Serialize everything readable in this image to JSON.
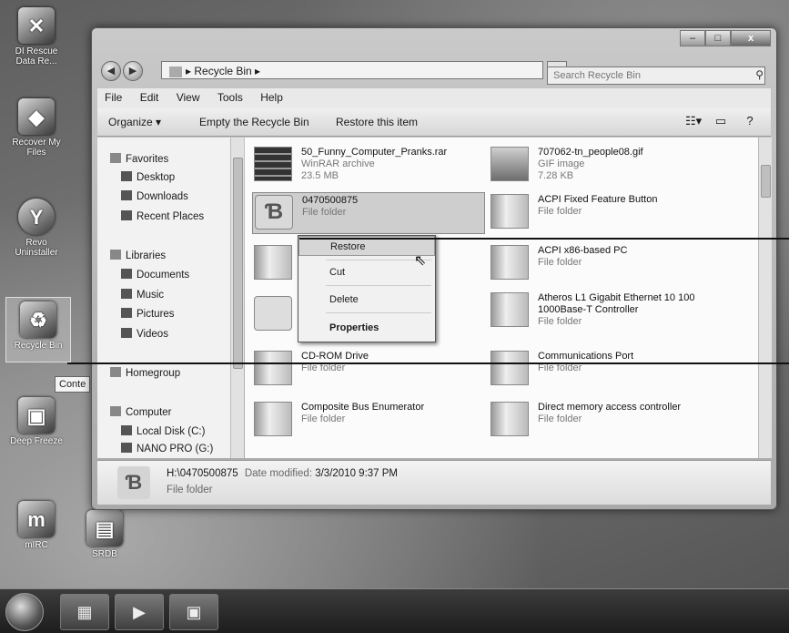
{
  "desktop": {
    "icons": [
      {
        "label": "DI Rescue Data Re..."
      },
      {
        "label": "Recover My Files"
      },
      {
        "label": "Revo Uninstaller"
      },
      {
        "label": "Recycle Bin"
      },
      {
        "label": "Deep Freeze"
      },
      {
        "label": "mIRC"
      },
      {
        "label": "SRDB"
      }
    ],
    "tooltip": "Conte"
  },
  "window": {
    "caption_min": "–",
    "caption_max": "□",
    "caption_close": "x",
    "address": "Recycle Bin",
    "search_placeholder": "Search Recycle Bin",
    "menu": [
      "File",
      "Edit",
      "View",
      "Tools",
      "Help"
    ],
    "toolbar": {
      "organize": "Organize ▾",
      "empty": "Empty the Recycle Bin",
      "restore_all": "Restore this item"
    }
  },
  "navpane": {
    "favorites": "Favorites",
    "favorites_items": [
      "Desktop",
      "Downloads",
      "Recent Places"
    ],
    "libraries": "Libraries",
    "libraries_items": [
      "Documents",
      "Music",
      "Pictures",
      "Videos"
    ],
    "homegroup": "Homegroup",
    "computer": "Computer",
    "computer_items": [
      "Local Disk (C:)",
      "NANO PRO (G:)"
    ]
  },
  "files": [
    {
      "name": "50_Funny_Computer_Pranks.rar",
      "type": "WinRAR archive",
      "size": "23.5 MB"
    },
    {
      "name": "707062-tn_people08.gif",
      "type": "GIF image",
      "size": "7.28 KB"
    },
    {
      "name": "0470500875",
      "type": "File folder"
    },
    {
      "name": "ACPI Fixed Feature Button",
      "type": "File folder"
    },
    {
      "name": "ACPI x86-based PC",
      "type": "File folder"
    },
    {
      "name": "Atheros L1 Gigabit Ethernet 10 100 1000Base-T Controller",
      "type": "File folder"
    },
    {
      "name": "CD-ROM Drive",
      "type": "File folder"
    },
    {
      "name": "Communications Port",
      "type": "File folder"
    },
    {
      "name": "Composite Bus Enumerator",
      "type": "File folder"
    },
    {
      "name": "Direct memory access controller",
      "type": "File folder"
    }
  ],
  "context_menu": {
    "restore": "Restore",
    "cut": "Cut",
    "delete": "Delete",
    "properties": "Properties"
  },
  "details": {
    "path": "H:\\0470500875",
    "modified_label": "Date modified:",
    "modified_value": "3/3/2010 9:37 PM",
    "type": "File folder"
  }
}
